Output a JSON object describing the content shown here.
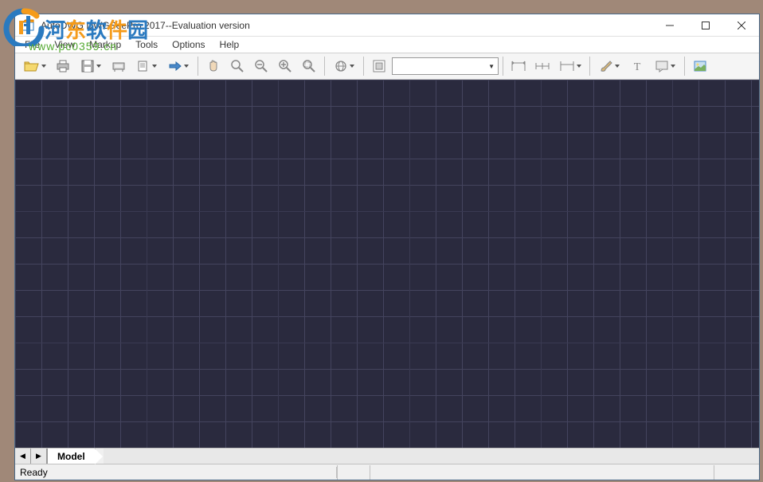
{
  "window": {
    "title": "AutoDWG DWGSeePro 2017--Evaluation version"
  },
  "menubar": {
    "items": [
      "File",
      "View",
      "Markup",
      "Tools",
      "Options",
      "Help"
    ]
  },
  "toolbar": {
    "open": "Open",
    "print": "Print",
    "save": "Save",
    "plotter": "Plotter",
    "back": "Back",
    "forward": "Forward",
    "pan": "Pan",
    "zoom_window": "Zoom Window",
    "zoom_out": "Zoom Out",
    "zoom_in": "Zoom In",
    "zoom_extents": "Zoom Extents",
    "region": "Region",
    "layout": "Layout",
    "layer_combo": "",
    "dim_aligned": "Aligned Dimension",
    "dim_linear": "Linear Dimension",
    "dim_angular": "Angular Dimension",
    "distance": "Distance",
    "brush": "Brush",
    "text": "Text",
    "note": "Note",
    "image": "Image"
  },
  "tabs": {
    "prev": "◀",
    "next": "▶",
    "model": "Model"
  },
  "statusbar": {
    "ready": "Ready"
  },
  "watermark": {
    "text": "河东软件园",
    "url": "www.pc0359.cn"
  }
}
